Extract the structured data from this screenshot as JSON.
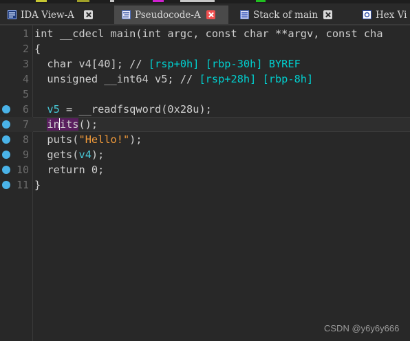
{
  "tabs": [
    {
      "label": "IDA View-A",
      "active": false,
      "icon": "ida-view-icon"
    },
    {
      "label": "Pseudocode-A",
      "active": true,
      "icon": "pseudocode-icon"
    },
    {
      "label": "Stack of main",
      "active": false,
      "icon": "stack-icon"
    },
    {
      "label": "Hex Vi",
      "active": false,
      "icon": "hex-view-icon"
    }
  ],
  "code": {
    "line_numbers": [
      "1",
      "2",
      "3",
      "4",
      "5",
      "6",
      "7",
      "8",
      "9",
      "10",
      "11"
    ],
    "l1": "int __cdecl main(int argc, const char **argv, const cha",
    "l2": "{",
    "l3_decl": "  char v4[40]; // ",
    "l3_reg": "[rsp+0h] [rbp-30h] BYREF",
    "l4_decl": "  unsigned __int64 v5; // ",
    "l4_reg": "[rsp+28h] [rbp-8h]",
    "l6_var": "v5",
    "l6_rest": " = __readfsqword(0x28u);",
    "l7_a": "in",
    "l7_b": "its",
    "l7_rest": "();",
    "l8_fn": "puts(",
    "l8_str": "\"Hello!\"",
    "l8_end": ");",
    "l9_fn": "gets(",
    "l9_var": "v4",
    "l9_end": ");",
    "l10": "  return 0;",
    "l11": "}"
  },
  "breakpoint_lines": [
    "6",
    "7",
    "8",
    "9",
    "10",
    "11"
  ],
  "colors": {
    "breakpoint": "#4ab3e8",
    "register_comment": "#00d0d0",
    "string": "#f29b3a",
    "highlight": "#5a1f5f",
    "close_active": "#f05050"
  },
  "watermark": "CSDN @y6y6y666"
}
